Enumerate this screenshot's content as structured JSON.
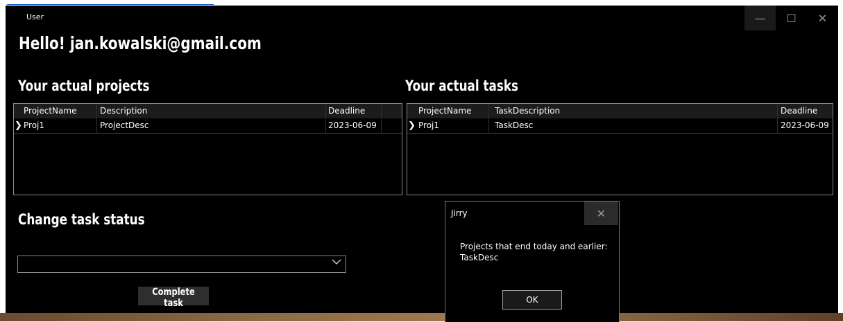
{
  "window": {
    "title": "User",
    "controls": {
      "minimize": "—",
      "maximize": "☐",
      "close": "✕"
    }
  },
  "greeting": "Hello! jan.kowalski@gmail.com",
  "projects": {
    "heading": "Your actual projects",
    "columns": [
      "ProjectName",
      "Description",
      "Deadline"
    ],
    "rows": [
      {
        "cells": [
          "Proj1",
          "ProjectDesc",
          "2023-06-09"
        ]
      }
    ]
  },
  "tasks": {
    "heading": "Your actual tasks",
    "columns": [
      "ProjectName",
      "TaskDescription",
      "Deadline"
    ],
    "rows": [
      {
        "cells": [
          "Proj1",
          "TaskDesc",
          "2023-06-09"
        ]
      }
    ]
  },
  "status": {
    "heading": "Change task status",
    "select_value": "",
    "complete_button": "Complete task"
  },
  "dialog": {
    "title": "Jirry",
    "message_line1": "Projects that end today and earlier:",
    "message_line2": "TaskDesc",
    "ok_label": "OK"
  },
  "icons": {
    "row_indicator": "row-indicator-icon",
    "dropdown": "chevron-down-icon",
    "close": "close-icon"
  },
  "colors": {
    "window_bg": "#000000",
    "header_bg": "#1c1c1c",
    "border": "#8a8a8a",
    "button_bg": "#2e2e2e"
  }
}
